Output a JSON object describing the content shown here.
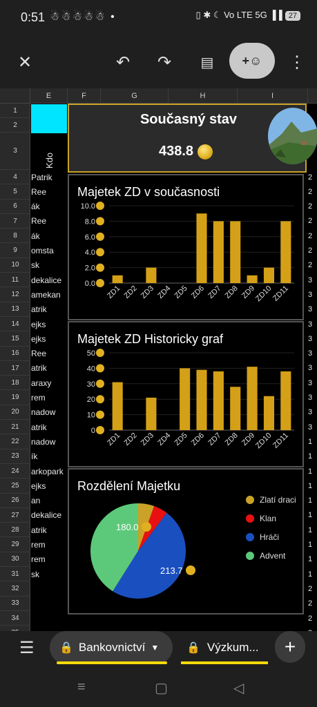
{
  "status": {
    "time": "0:51",
    "notif": "☃☃☃☃☃ •",
    "right": "▯ ✱ ☾ Vo LTE 5G ▐▐",
    "battery": "27"
  },
  "toolbar": {
    "close": "✕",
    "undo": "↶",
    "redo": "↷",
    "comment": "▤",
    "add_person": "+☺",
    "more": "⋮"
  },
  "columns": [
    "E",
    "F",
    "G",
    "H",
    "I"
  ],
  "rows": [
    "1",
    "2",
    "3",
    "4",
    "5",
    "6",
    "7",
    "8",
    "9",
    "10",
    "11",
    "12",
    "13",
    "14",
    "15",
    "16",
    "17",
    "18",
    "19",
    "20",
    "21",
    "22",
    "23",
    "24",
    "25",
    "26",
    "27",
    "28",
    "29",
    "30",
    "31",
    "32",
    "33",
    "34",
    "35"
  ],
  "col_e_header": "Kdo",
  "col_e": [
    "Patrik",
    "Ree",
    "ák",
    "Ree",
    "ák",
    "omsta",
    "sk",
    "dekalice",
    "amekan",
    "atrik",
    "ejks",
    "ejks",
    "Ree",
    "atrik",
    "araxy",
    "rem",
    "nadow",
    "atrik",
    "nadow",
    "ík",
    "arkopark",
    "ejks",
    "an",
    "dekalice",
    "atrik",
    "rem",
    "rem",
    "sk"
  ],
  "col_right": [
    "2",
    "2",
    "2",
    "2",
    "2",
    "2",
    "2",
    "3",
    "3",
    "3",
    "3",
    "3",
    "3",
    "3",
    "3",
    "3",
    "3",
    "3",
    "1",
    "1",
    "1",
    "1",
    "1",
    "1",
    "1",
    "1",
    "1",
    "1",
    "2",
    "2",
    "2",
    "2"
  ],
  "summary": {
    "title": "Současný stav",
    "total": "438.8"
  },
  "accent": "#c9a227",
  "chart_data": [
    {
      "type": "bar",
      "title": "Majetek ZD v současnosti",
      "categories": [
        "ZD1",
        "ZD2",
        "ZD3",
        "ZD4",
        "ZD5",
        "ZD6",
        "ZD7",
        "ZD8",
        "ZD9",
        "ZD10",
        "ZD11"
      ],
      "values": [
        1,
        0,
        2,
        0,
        0,
        9,
        8,
        8,
        1,
        2,
        8
      ],
      "yticks": [
        "10.0",
        "8.0",
        "6.0",
        "4.0",
        "2.0",
        "0.0"
      ],
      "ylim": [
        0,
        10
      ],
      "color": "#d4a017"
    },
    {
      "type": "bar",
      "title": "Majetek ZD Historicky graf",
      "categories": [
        "ZD1",
        "ZD2",
        "ZD3",
        "ZD4",
        "ZD5",
        "ZD6",
        "ZD7",
        "ZD8",
        "ZD9",
        "ZD10",
        "ZD11"
      ],
      "values": [
        31,
        0,
        21,
        0,
        40,
        39,
        38,
        28,
        41,
        22,
        38
      ],
      "yticks": [
        "50",
        "40",
        "30",
        "20",
        "10",
        "0"
      ],
      "ylim": [
        0,
        50
      ],
      "color": "#d4a017"
    },
    {
      "type": "pie",
      "title": "Rozdělení Majetku",
      "slices": [
        {
          "name": "Zlatí draci",
          "value": 24,
          "color": "#c9a227"
        },
        {
          "name": "Klan",
          "value": 21,
          "color": "#e81010"
        },
        {
          "name": "Hráči",
          "value": 213.7,
          "color": "#1a4fbf"
        },
        {
          "name": "Advent",
          "value": 180.0,
          "color": "#5cc97a"
        }
      ],
      "labels": [
        "180.0",
        "213.7"
      ]
    }
  ],
  "tabs": {
    "menu": "☰",
    "tab1": "Bankovnictví",
    "tab2": "Výzkum...",
    "add": "+"
  },
  "nav": {
    "recent": "≡",
    "home": "▢",
    "back": "◁"
  }
}
